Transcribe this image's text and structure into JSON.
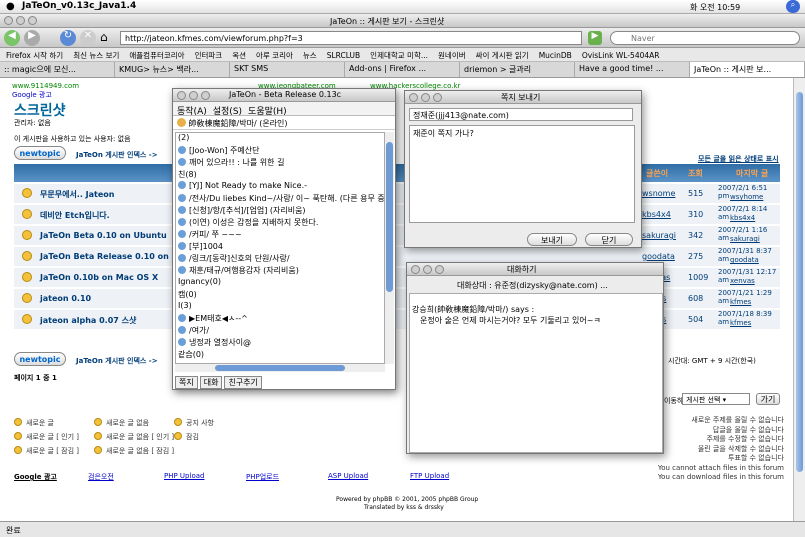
{
  "mac_menubar": {
    "app": "JaTeOn_v0.13c_Java1.4",
    "clock": "화 오전 10:59"
  },
  "browser": {
    "title": "JaTeOn :: 게시판 보기 - 스크린샷",
    "url": "http://jateon.kfmes.com/viewforum.php?f=3",
    "search_placeholder": "Naver",
    "bookmarks": [
      "Firefox 시작 하기",
      "최신 뉴스 보기",
      "애플컴퓨터코리아",
      "인터파크",
      "옥션",
      "아루 코리아",
      "뉴스",
      "SLRCLUB",
      "인제대학교 미학...",
      "원네이버",
      "싸이 게시판 읽기",
      "MucinDB",
      "OvisLink WL-5404AR"
    ],
    "tabs": [
      ":: magic으에 모신...",
      "KMUG> 뉴스> 백라...",
      "SKT SMS",
      "Add-ons | Firefox ...",
      "driemon > 글과리",
      "Have a good time! ...",
      "JaTeOn :: 게시판 보..."
    ],
    "status": "완료"
  },
  "forum": {
    "url_left": "www.9114949.com",
    "url_mid": "www.jeongbateer.com",
    "url_right": "www.hackerscollege.co.kr",
    "google_ad": "Google 광고",
    "heading": "스크린샷",
    "moderator": "관리자: 없음",
    "viewing": "이 게시판을 사용하고 있는 사용자: 없음",
    "newtopic": "newtopic",
    "breadcrumb": "JaTeOn 게시판 인덱스 ->",
    "mark_read": "모든 글을 읽은 상태로 표시",
    "col_author": "글쓴이",
    "col_views": "조회",
    "col_last": "마지막 글",
    "topics": [
      {
        "title": "무문무에서.. Jateon",
        "author": "wsnome",
        "views": "515",
        "last_date": "2007/2/1 6:51 pm",
        "last_user": "wsyhome"
      },
      {
        "title": "데비안 Etch입니다.",
        "author": "kbs4x4",
        "views": "310",
        "last_date": "2007/2/1 8:14 am",
        "last_user": "kbs4x4"
      },
      {
        "title": "JaTeOn Beta 0.10 on Ubuntu",
        "author": "sakuragi",
        "views": "342",
        "last_date": "2007/2/1 1:16 am",
        "last_user": "sakuragi"
      },
      {
        "title": "JaTeOn Beta Release 0.10 on Fedora",
        "author": "goodata",
        "views": "275",
        "last_date": "2007/1/31 8:37 am",
        "last_user": "goodata"
      },
      {
        "title": "JaTeOn 0.10b on Mac OS X",
        "author": "xenvas",
        "views": "1009",
        "last_date": "2007/1/31 12:17 am",
        "last_user": "xenvas"
      },
      {
        "title": "jateon 0.10",
        "author": "kfmes",
        "views": "608",
        "last_date": "2007/1/21 1:29 am",
        "last_user": "kfmes"
      },
      {
        "title": "jateon alpha 0.07 스샷",
        "author": "kfmes",
        "views": "504",
        "last_date": "2007/1/18 8:39 am",
        "last_user": "kfmes"
      }
    ],
    "page_info": "페이지 1 중 1",
    "timezone": "시간대: GMT + 9 시간(한국)",
    "jump_label": "게시판 선택",
    "go": "가기",
    "jump_prefix": "이동하기:",
    "legend": [
      "새로운 글",
      "새로운 글 없음",
      "공지 사항",
      "새로운 글 [ 인기 ]",
      "새로운 글 없음 [ 인기 ]",
      "잠김",
      "새로운 글 [ 잠김 ]",
      "새로운 글 없음 [ 잠김 ]"
    ],
    "permissions": [
      "새로운 주제를 올릴 수 없습니다",
      "답글을 올릴 수 없습니다",
      "주제를 수정할 수 없습니다",
      "올린 글을 삭제할 수 없습니다",
      "투표할 수 없습니다",
      "You cannot attach files in this forum",
      "You can download files in this forum"
    ],
    "footer_links": [
      "Google 광고",
      "검은오전",
      "PHP Upload",
      "PHP업로드",
      "ASP Upload",
      "FTP Upload"
    ],
    "powered": "Powered by phpBB © 2001, 2005 phpBB Group",
    "translated": "Translated by kss & drssky"
  },
  "jateon": {
    "title": "JaTeOn - Beta Release 0.13c",
    "menu": [
      "동작(A)",
      "설정(S)",
      "도움말(H)"
    ],
    "me": "帥敎棟魔鉛障/박마/ (온라인)",
    "buddies": [
      "(2)",
      "[Joo-Won] 주예산단",
      "깨어 있으라!! : 나를 위한 길",
      "친(8)",
      "[YJ] Not Ready to make Nice.-",
      "/전사/Du liebes Kind~/사랑/ 이~ 푹탄해. (다른 용무 중)",
      "[신청]/항/[추석]/[업업] (자리비움)",
      "(이연) 이성은 감정을 지배하지 못한다.",
      "/커피/ 쭈 ~~~",
      "[부]1004",
      "/링크/[동락]신호의 단원/사랑/",
      "재훈/태규/여행용감자 (자리비움)",
      "Ignancy(0)",
      "캠(0)",
      "I(3)",
      "▶EM태호◀ㅅ--^",
      "/여가/",
      "냉정과 열정사이@",
      "같습(0)"
    ],
    "tabs": [
      "쪽지",
      "대화",
      "친구추기"
    ]
  },
  "note": {
    "title": "쪽지 보내기",
    "to": "정재준(jjj413@nate.com)",
    "body": "재준이 쪽지 가나?",
    "send": "보내기",
    "close": "닫기"
  },
  "chat": {
    "title": "대화하기",
    "partner": "대화상대 : 유준정(dizysky@nate.com) ...",
    "speaker": "강승희(帥敎棟魔鉛障/박마/) says :",
    "message": "운정아 술은 언제 마시는거야? 모두 기둘리고 있어~ㅋ"
  }
}
